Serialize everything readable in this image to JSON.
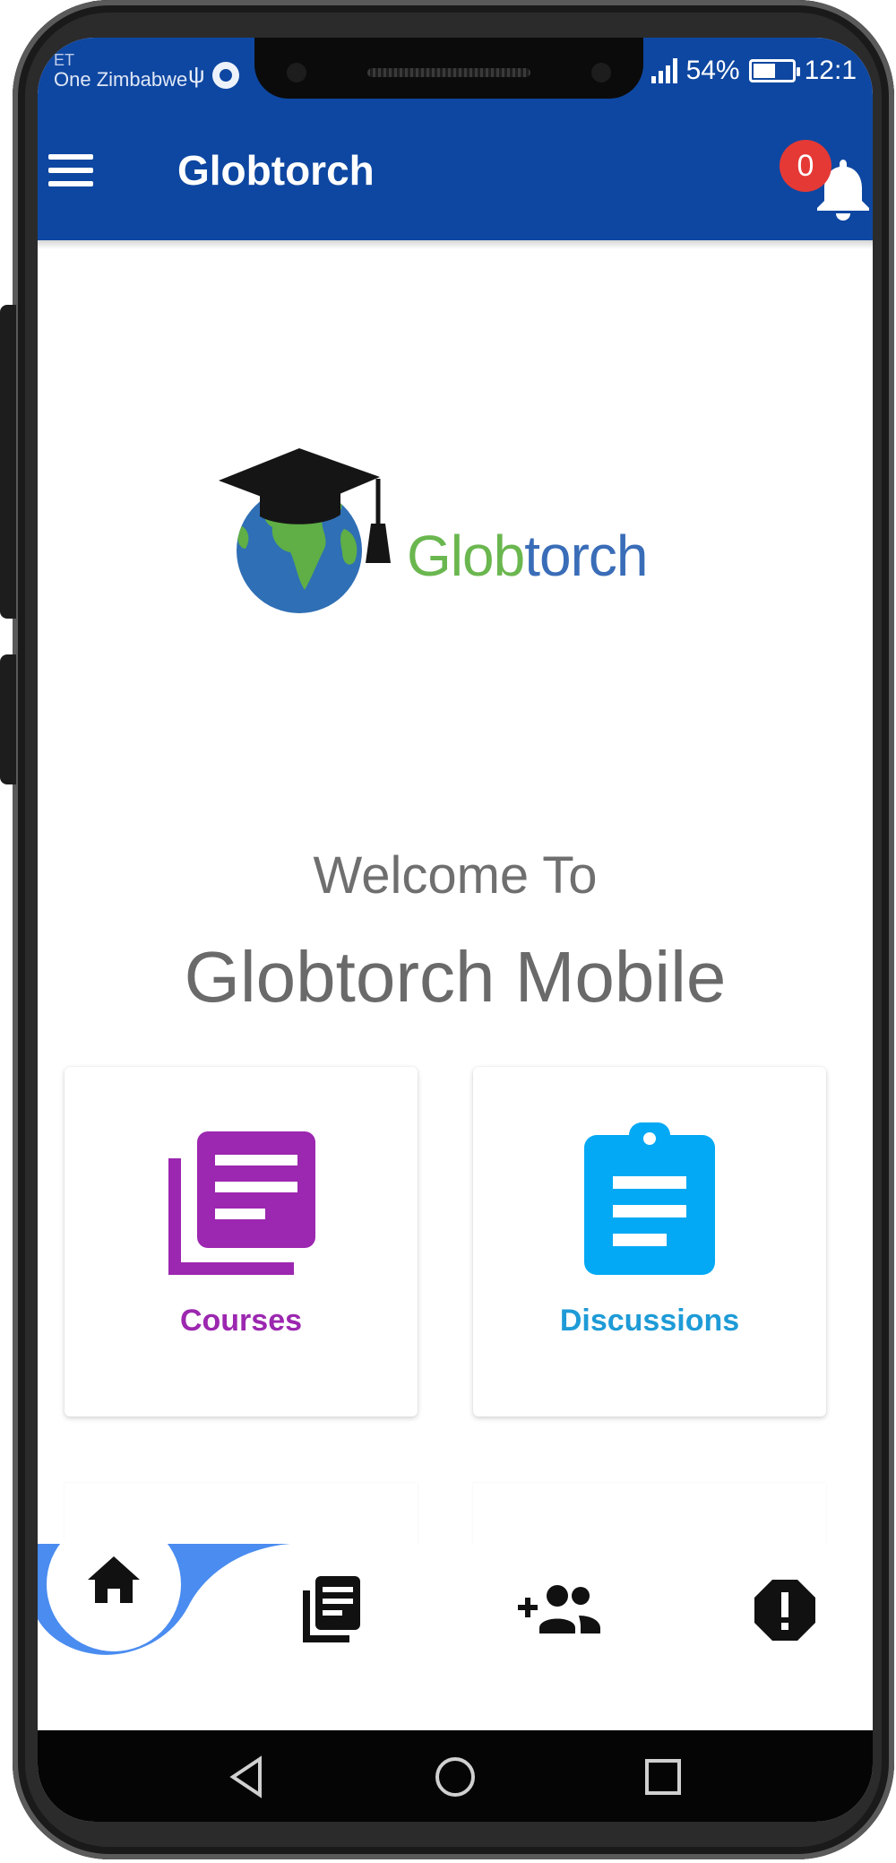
{
  "status_bar": {
    "carrier_top": "ET",
    "carrier": "One Zimbabwe",
    "battery_percent": "54%",
    "time": "12:1"
  },
  "app_bar": {
    "title": "Globtorch",
    "notification_count": "0"
  },
  "logo": {
    "text_part1": "Glob",
    "text_part2": "torch"
  },
  "welcome": {
    "line1": "Welcome To",
    "line2": "Globtorch Mobile"
  },
  "tiles": [
    {
      "label": "Courses",
      "icon": "library-books-icon",
      "color": "#9c27b0"
    },
    {
      "label": "Discussions",
      "icon": "clipboard-icon",
      "color": "#03a9f4"
    }
  ],
  "bottom_nav": {
    "items": [
      "home-icon",
      "library-books-icon",
      "add-group-icon",
      "report-icon"
    ],
    "accent_color": "#4a8cf0"
  },
  "colors": {
    "app_bar": "#0e47a1",
    "badge": "#e53935"
  }
}
